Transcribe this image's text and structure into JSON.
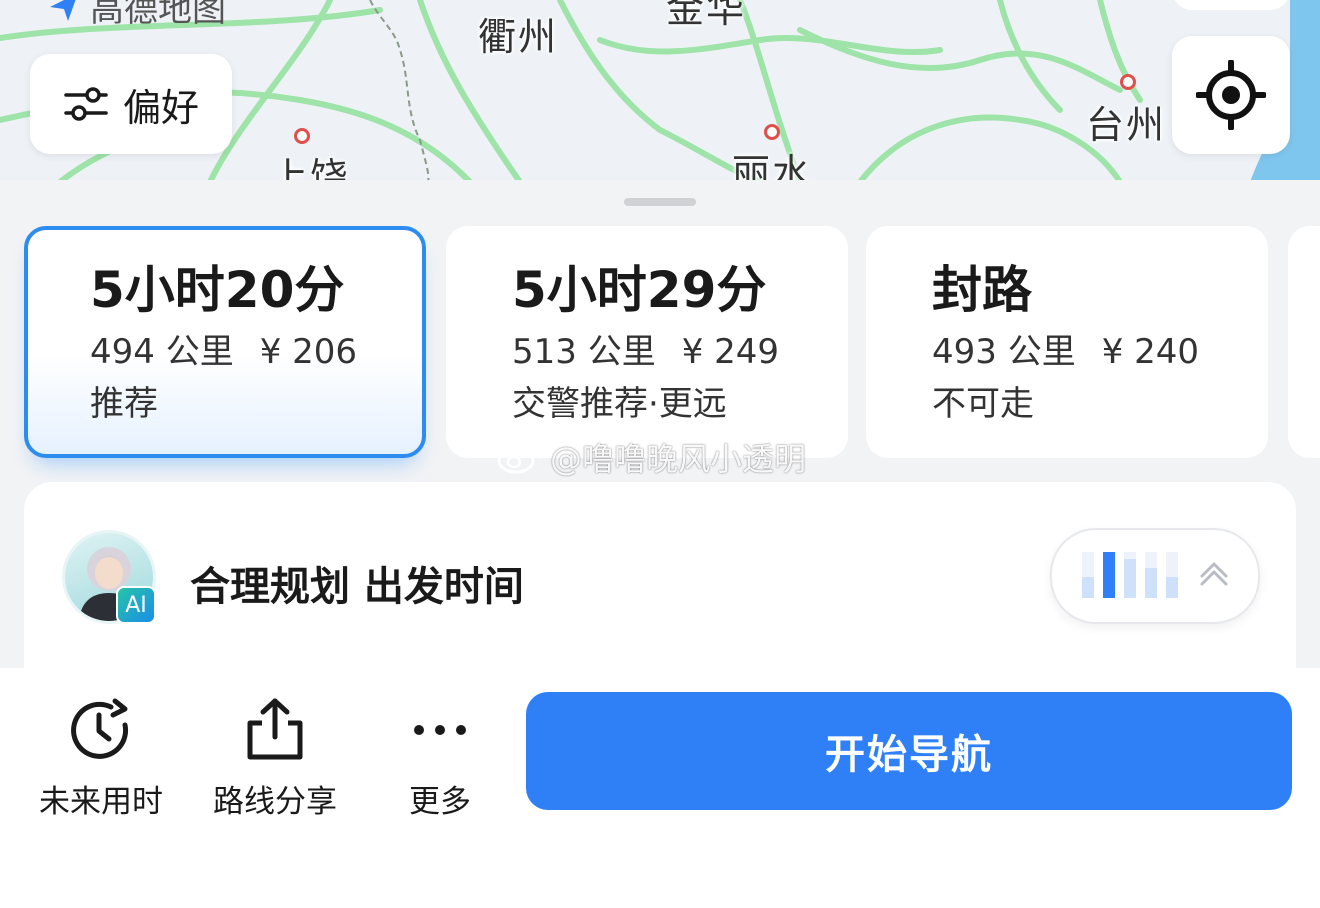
{
  "map": {
    "app_name": "高德地图",
    "cities": [
      "衢州",
      "金华",
      "台州",
      "上饶",
      "丽水"
    ],
    "road_color": "#9ee3a8"
  },
  "preference_button": {
    "icon": "sliders-icon",
    "label": "偏好"
  },
  "locate_button": {
    "icon": "locate-target-icon"
  },
  "routes": [
    {
      "time": "5小时20分",
      "distance": "494 公里",
      "cost": "¥ 206",
      "tag": "推荐",
      "selected": true
    },
    {
      "time": "5小时29分",
      "distance": "513 公里",
      "cost": "¥ 249",
      "tag": "交警推荐·更远",
      "selected": false
    },
    {
      "time": "封路",
      "distance": "493 公里",
      "cost": "¥ 240",
      "tag": "不可走",
      "selected": false
    }
  ],
  "watermark": "@噜噜晚风小透明",
  "ai_panel": {
    "badge": "AI",
    "title": "合理规划 出发时间",
    "toggle_icon": "chevron-up-icon",
    "bar_levels": [
      0.45,
      1.0,
      0.85,
      0.65,
      0.45
    ],
    "accent": "#2f80f7"
  },
  "bottom_bar": {
    "future_time": {
      "icon": "clock-icon",
      "label": "未来用时"
    },
    "share": {
      "icon": "share-icon",
      "label": "路线分享"
    },
    "more": {
      "icon": "more-dots-icon",
      "label": "更多"
    },
    "start_nav": "开始导航"
  },
  "colors": {
    "primary": "#2f80f7",
    "selected_border": "#2d8cf0",
    "sheet_bg": "#f2f3f5"
  }
}
